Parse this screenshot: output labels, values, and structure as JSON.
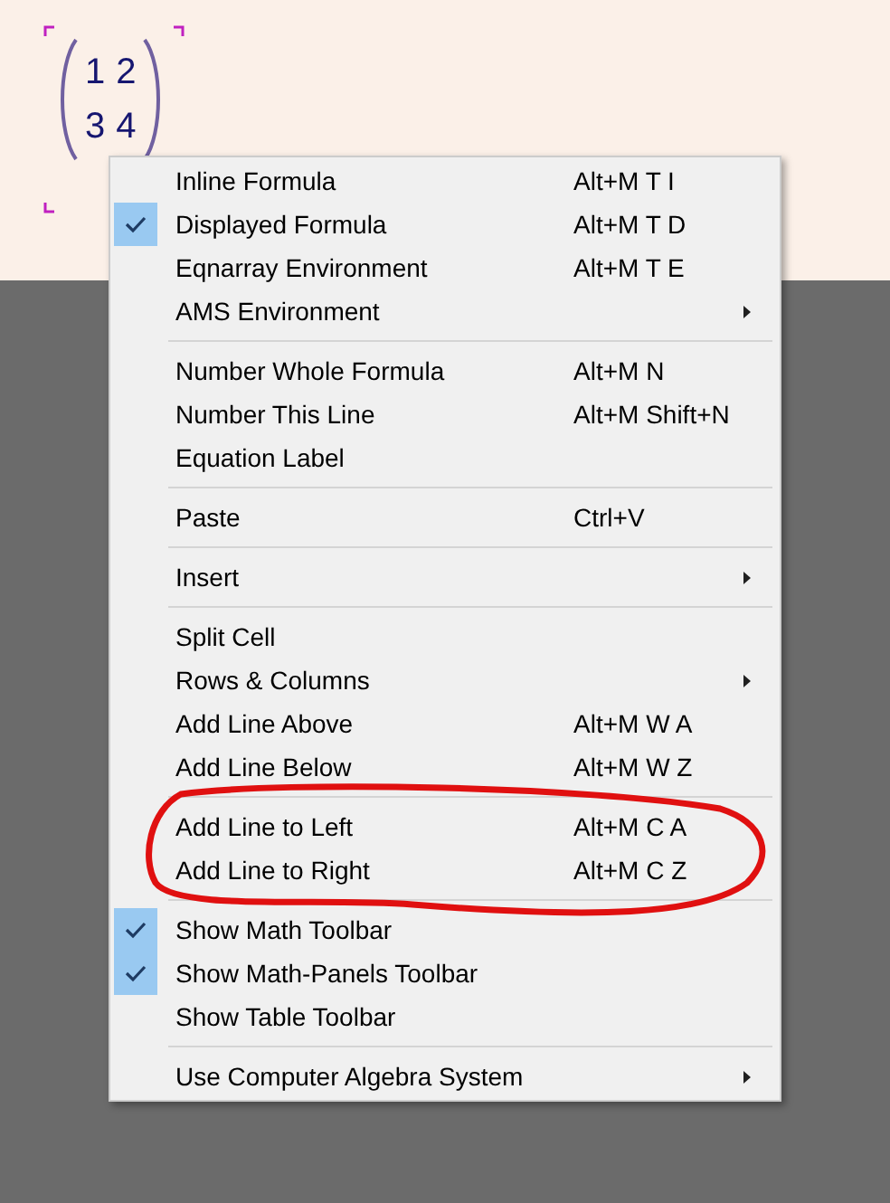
{
  "matrix": {
    "rows": [
      [
        "1",
        "2"
      ],
      [
        "3",
        "4"
      ]
    ]
  },
  "context_menu": {
    "sections": [
      {
        "items": [
          {
            "label": "Inline Formula",
            "shortcut": "Alt+M T I",
            "checked": false,
            "submenu": false
          },
          {
            "label": "Displayed Formula",
            "shortcut": "Alt+M T D",
            "checked": true,
            "submenu": false
          },
          {
            "label": "Eqnarray Environment",
            "shortcut": "Alt+M T E",
            "checked": false,
            "submenu": false
          },
          {
            "label": "AMS Environment",
            "checked": false,
            "submenu": true
          }
        ]
      },
      {
        "items": [
          {
            "label": "Number Whole Formula",
            "shortcut": "Alt+M N",
            "checked": false,
            "submenu": false
          },
          {
            "label": "Number This Line",
            "shortcut": "Alt+M Shift+N",
            "checked": false,
            "submenu": false
          },
          {
            "label": "Equation Label",
            "checked": false,
            "submenu": false
          }
        ]
      },
      {
        "items": [
          {
            "label": "Paste",
            "shortcut": "Ctrl+V",
            "checked": false,
            "submenu": false
          }
        ]
      },
      {
        "items": [
          {
            "label": "Insert",
            "checked": false,
            "submenu": true
          }
        ]
      },
      {
        "items": [
          {
            "label": "Split Cell",
            "checked": false,
            "submenu": false
          },
          {
            "label": "Rows & Columns",
            "checked": false,
            "submenu": true
          },
          {
            "label": "Add Line Above",
            "shortcut": "Alt+M W A",
            "checked": false,
            "submenu": false
          },
          {
            "label": "Add Line Below",
            "shortcut": "Alt+M W Z",
            "checked": false,
            "submenu": false
          }
        ]
      },
      {
        "items": [
          {
            "label": "Add Line to Left",
            "shortcut": "Alt+M C A",
            "checked": false,
            "submenu": false
          },
          {
            "label": "Add Line to Right",
            "shortcut": "Alt+M C Z",
            "checked": false,
            "submenu": false
          }
        ]
      },
      {
        "items": [
          {
            "label": "Show Math Toolbar",
            "checked": true,
            "submenu": false
          },
          {
            "label": "Show Math-Panels Toolbar",
            "checked": true,
            "submenu": false
          },
          {
            "label": "Show Table Toolbar",
            "checked": false,
            "submenu": false
          }
        ]
      },
      {
        "items": [
          {
            "label": "Use Computer Algebra System",
            "checked": false,
            "submenu": true
          }
        ]
      }
    ]
  }
}
